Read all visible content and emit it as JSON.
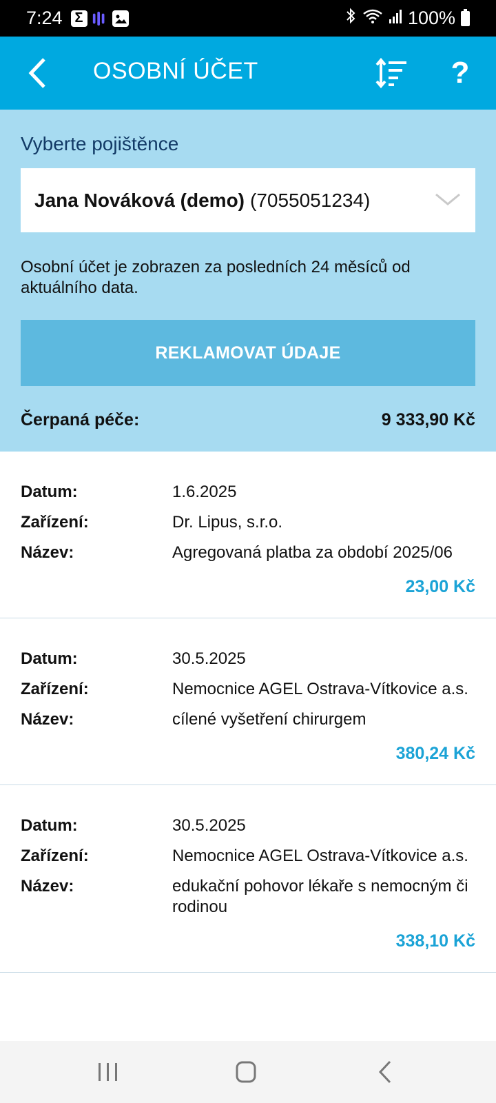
{
  "status_bar": {
    "time": "7:24",
    "battery": "100%"
  },
  "app_bar": {
    "title": "OSOBNÍ ÚČET"
  },
  "filter": {
    "label": "Vyberte pojištěnce",
    "selected_name": "Jana Nováková (demo)",
    "selected_number": "(7055051234)",
    "info": "Osobní účet je zobrazen za posledních 24 měsíců od aktuálního data.",
    "claim_button": "REKLAMOVAT ÚDAJE",
    "total_label": "Čerpaná péče:",
    "total_value": "9 333,90 Kč"
  },
  "labels": {
    "date": "Datum:",
    "facility": "Zařízení:",
    "name": "Název:"
  },
  "records": [
    {
      "date": "1.6.2025",
      "facility": "Dr. Lipus, s.r.o.",
      "name": "Agregovaná platba za období 2025/06",
      "amount": "23,00 Kč"
    },
    {
      "date": "30.5.2025",
      "facility": "Nemocnice AGEL Ostrava-Vítkovice a.s.",
      "name": "cílené vyšetření chirurgem",
      "amount": "380,24 Kč"
    },
    {
      "date": "30.5.2025",
      "facility": "Nemocnice AGEL Ostrava-Vítkovice a.s.",
      "name": "edukační pohovor lékaře s nemocným či rodinou",
      "amount": "338,10 Kč"
    }
  ],
  "colors": {
    "accent": "#00a9e0",
    "panel": "#a7dbf1",
    "button": "#5db9df",
    "amount": "#1ba3d6"
  }
}
